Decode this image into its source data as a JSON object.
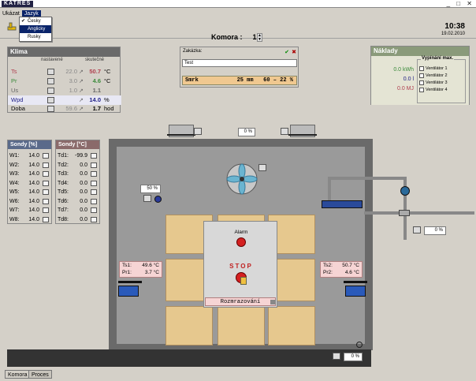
{
  "app": {
    "title": "KATRES"
  },
  "menu": {
    "items": [
      "Ukázat",
      "Jazyk"
    ],
    "language_options": [
      "Česky",
      "Anglicky",
      "Rusky"
    ],
    "selected_index": 1
  },
  "clock": {
    "time": "10:38",
    "date": "19.02.2010"
  },
  "komora": {
    "label": "Komora :",
    "value": "1"
  },
  "klima": {
    "title": "Klima",
    "col_set": "nastavené",
    "col_actual": "skutečné",
    "rows": [
      {
        "label": "Ts",
        "set": "22.0",
        "actual": "50.7",
        "unit": "°C",
        "color": "#b04050"
      },
      {
        "label": "Pr",
        "set": "3.0",
        "actual": "4.6",
        "unit": "°C",
        "color": "#3a8a3a"
      },
      {
        "label": "Us",
        "set": "1.0",
        "actual": "1.1",
        "unit": "",
        "color": "#666666"
      },
      {
        "label": "Wpd",
        "set": "",
        "actual": "14.0",
        "unit": "%",
        "color": "#222288"
      },
      {
        "label": "Doba",
        "set": "59.6",
        "actual": "1.7",
        "unit": "hod",
        "color": "#000000"
      }
    ]
  },
  "zakazka": {
    "label": "Zakázka:",
    "value": "Test",
    "program": "Smrk",
    "program_values": "25 mm   60 – 22 %"
  },
  "naklady": {
    "title": "Náklady",
    "values": [
      "0.0 kWh",
      "0.0 l",
      "0.0 MJ"
    ],
    "value_colors": [
      "#3a8a3a",
      "#222288",
      "#b04050"
    ],
    "group_title": "Vypínání max.",
    "fans": [
      "Ventilátor 1",
      "Ventilátor 2",
      "Ventilátor 3",
      "Ventilátor 4"
    ]
  },
  "sondy_w": {
    "title": "Sondy [%]",
    "rows": [
      {
        "l": "W1:",
        "v": "14.0"
      },
      {
        "l": "W2:",
        "v": "14.0"
      },
      {
        "l": "W3:",
        "v": "14.0"
      },
      {
        "l": "W4:",
        "v": "14.0"
      },
      {
        "l": "W5:",
        "v": "14.0"
      },
      {
        "l": "W6:",
        "v": "14.0"
      },
      {
        "l": "W7:",
        "v": "14.0"
      },
      {
        "l": "W8:",
        "v": "14.0"
      }
    ]
  },
  "sondy_t": {
    "title": "Sondy [°C]",
    "rows": [
      {
        "l": "Td1:",
        "v": "-99.9"
      },
      {
        "l": "Td2:",
        "v": "0.0"
      },
      {
        "l": "Td3:",
        "v": "0.0"
      },
      {
        "l": "Td4:",
        "v": "0.0"
      },
      {
        "l": "Td5:",
        "v": "0.0"
      },
      {
        "l": "Td6:",
        "v": "0.0"
      },
      {
        "l": "Td7:",
        "v": "0.0"
      },
      {
        "l": "Td8:",
        "v": "0.0"
      }
    ]
  },
  "gauges": {
    "top_vent": "0 %",
    "left_damper": "50 %",
    "right_valve": "0 %",
    "bottom": "0 %"
  },
  "left_sensor": {
    "ts": "Ts1:",
    "ts_val": "49.6 °C",
    "pr": "Pr1:",
    "pr_val": "3.7 °C"
  },
  "right_sensor": {
    "ts": "Ts2:",
    "ts_val": "50.7 °C",
    "pr": "Pr2:",
    "pr_val": "4.6 °C"
  },
  "alarm": {
    "label": "Alarm",
    "stop": "STOP",
    "mode": "Rozmrazování"
  },
  "tabs": [
    "Komora",
    "Proces"
  ]
}
